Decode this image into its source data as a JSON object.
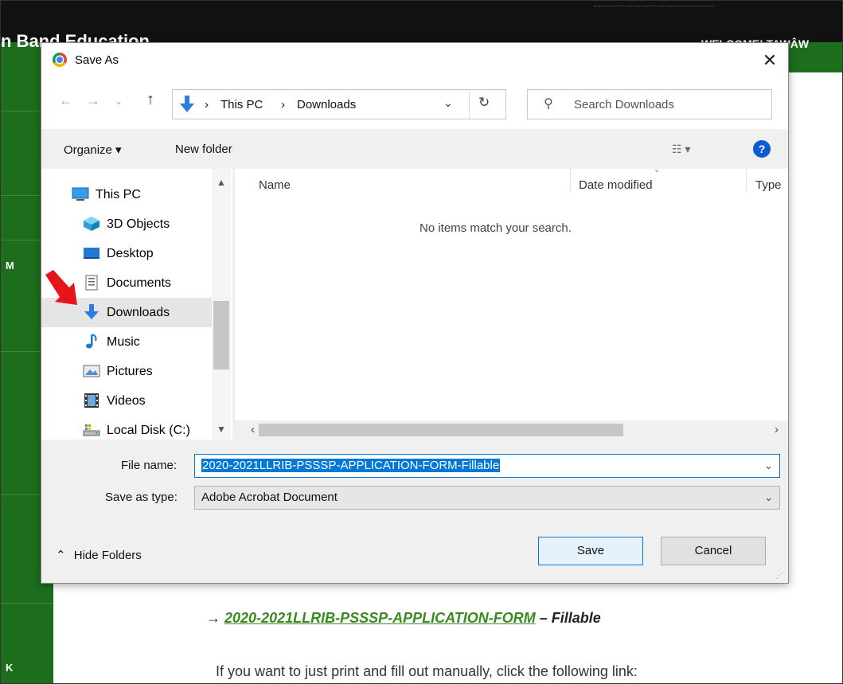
{
  "page": {
    "site_title": "n Band Education",
    "welcome": "WELCOME! TAWÂW",
    "nav_fragment_1": "M",
    "nav_fragment_2": "K",
    "doc_arrow": "→",
    "doc_link": "2020-2021LLRIB-PSSSP-APPLICATION-FORM",
    "doc_suffix": " – Fillable",
    "doc_text": "If you want to just print and fill out manually, click the following link:"
  },
  "dialog": {
    "title": "Save As",
    "close_label": "✕",
    "address": {
      "crumbs": [
        "This PC",
        "Downloads"
      ],
      "separator": "›",
      "search_placeholder": "Search Downloads"
    },
    "toolbar": {
      "organize": "Organize ▾",
      "new_folder": "New folder",
      "view": "☷ ▾",
      "help": "?"
    },
    "nav_tree": [
      {
        "label": "This PC",
        "icon": "computer-icon"
      },
      {
        "label": "3D Objects",
        "icon": "cube-icon"
      },
      {
        "label": "Desktop",
        "icon": "desktop-icon"
      },
      {
        "label": "Documents",
        "icon": "document-icon"
      },
      {
        "label": "Downloads",
        "icon": "download-arrow-icon",
        "selected": true
      },
      {
        "label": "Music",
        "icon": "music-note-icon"
      },
      {
        "label": "Pictures",
        "icon": "picture-icon"
      },
      {
        "label": "Videos",
        "icon": "film-icon"
      },
      {
        "label": "Local Disk (C:)",
        "icon": "drive-icon"
      }
    ],
    "columns": [
      "Name",
      "Date modified",
      "Type"
    ],
    "empty_message": "No items match your search.",
    "file_name_label": "File name:",
    "file_name_value": "2020-2021LLRIB-PSSSP-APPLICATION-FORM-Fillable",
    "save_type_label": "Save as type:",
    "save_type_value": "Adobe Acrobat Document",
    "hide_folders": "Hide Folders",
    "save_button": "Save",
    "cancel_button": "Cancel"
  },
  "colors": {
    "site_green": "#1c6e1c",
    "link_green": "#3a8a1f",
    "selection_blue": "#0078d7",
    "folder_blue": "#2b7de0",
    "annotation_red": "#e8141b"
  }
}
